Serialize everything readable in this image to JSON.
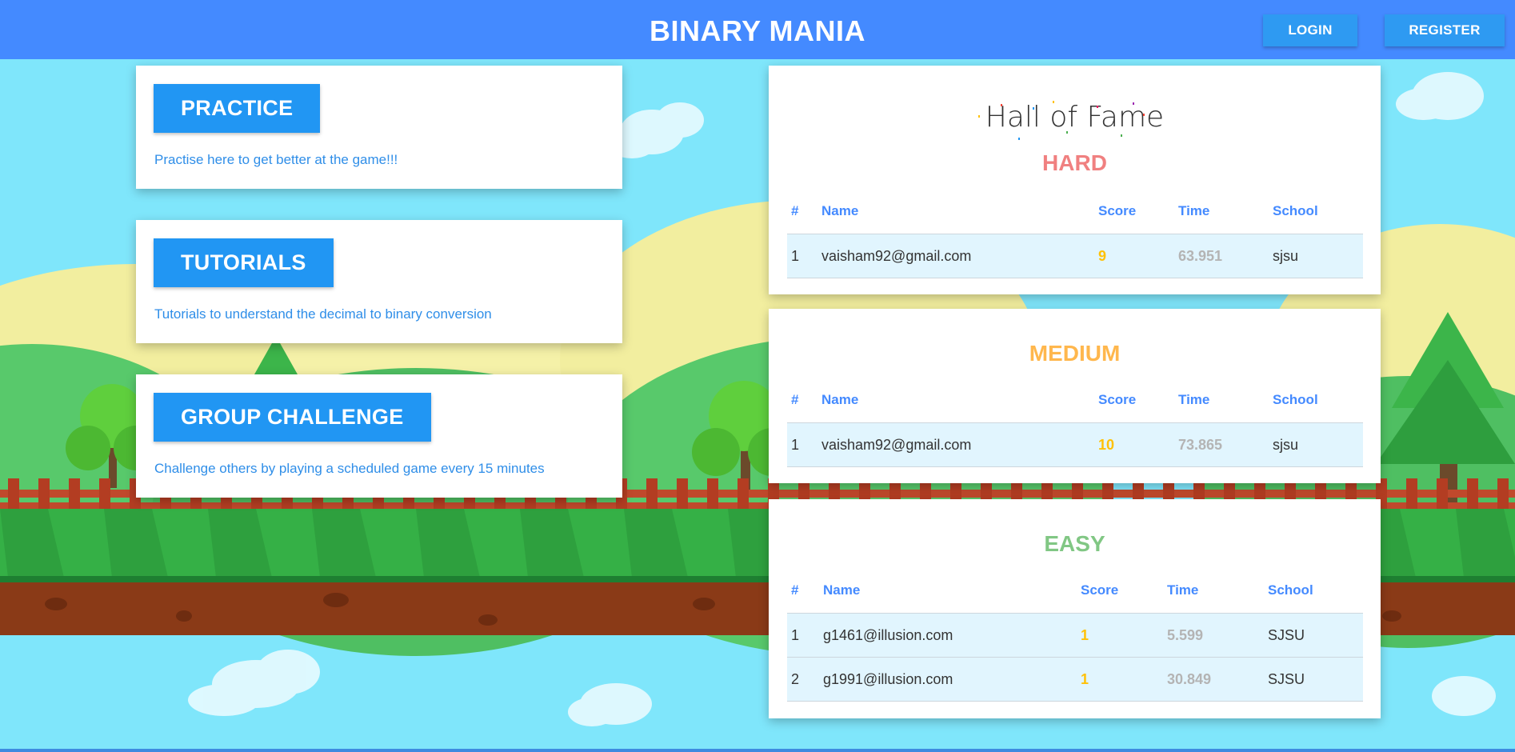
{
  "header": {
    "title": "BINARY MANIA",
    "login_label": "LOGIN",
    "register_label": "REGISTER"
  },
  "modes": [
    {
      "label": "PRACTICE",
      "description": "Practise here to get better at the game!!!"
    },
    {
      "label": "TUTORIALS",
      "description": "Tutorials to understand the decimal to binary conversion"
    },
    {
      "label": "GROUP CHALLENGE",
      "description": "Challenge others by playing a scheduled game every 15 minutes"
    }
  ],
  "hall_of_fame": {
    "title": "Hall of Fame",
    "columns": [
      "#",
      "Name",
      "Score",
      "Time",
      "School"
    ],
    "levels": [
      {
        "title": "HARD",
        "color": "#f08080",
        "rows": [
          {
            "rank": "1",
            "name": "vaisham92@gmail.com",
            "score": "9",
            "time": "63.951",
            "school": "sjsu"
          }
        ]
      },
      {
        "title": "MEDIUM",
        "color": "#ffb74d",
        "rows": [
          {
            "rank": "1",
            "name": "vaisham92@gmail.com",
            "score": "10",
            "time": "73.865",
            "school": "sjsu"
          }
        ]
      },
      {
        "title": "EASY",
        "color": "#81c784",
        "rows": [
          {
            "rank": "1",
            "name": "g1461@illusion.com",
            "score": "1",
            "time": "5.599",
            "school": "SJSU"
          },
          {
            "rank": "2",
            "name": "g1991@illusion.com",
            "score": "1",
            "time": "30.849",
            "school": "SJSU"
          }
        ]
      }
    ]
  },
  "colors": {
    "header_bg": "#448aff",
    "button_blue": "#2196f3",
    "link_blue": "#2f8ee8",
    "score_yellow": "#ffc107",
    "time_gray": "#b4b4b4",
    "row_bg": "#e1f5fe"
  }
}
